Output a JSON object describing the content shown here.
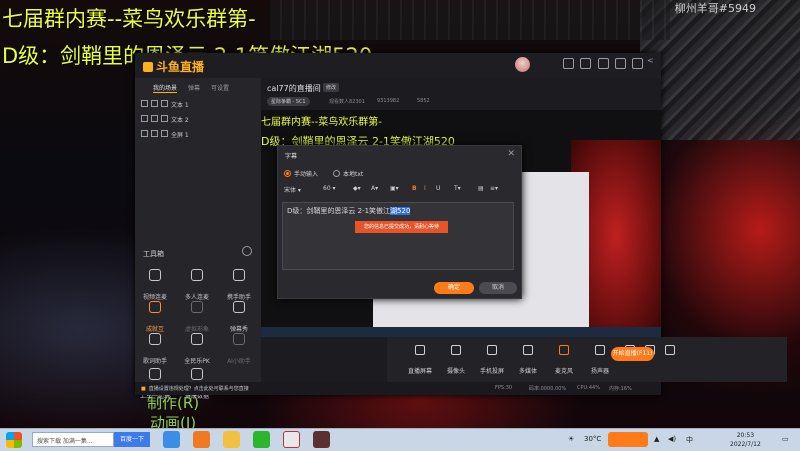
{
  "overlay": {
    "line1": "七届群内赛--菜鸟欢乐群第-",
    "line2": "D级：剑鞘里的恩泽云 2-1笑傲江湖520",
    "game_id": "柳州羊哥#5949",
    "zz1": "制作(R)",
    "zz2": "动画(I)"
  },
  "app": {
    "logo": "斗鱼直播",
    "sidebar_tabs": [
      "我的场景",
      "弹幕",
      "可设置"
    ],
    "layers": [
      "文本 1",
      "文本 2",
      "全屏 1"
    ],
    "tools_title": "工具箱",
    "tools": [
      {
        "label": "视频连麦",
        "state": "normal"
      },
      {
        "label": "多人连麦",
        "state": "normal"
      },
      {
        "label": "携手助手",
        "state": "normal"
      },
      {
        "label": "成就互",
        "state": "highlight"
      },
      {
        "label": "虚拟形象",
        "state": "dim"
      },
      {
        "label": "弹幕秀",
        "state": "normal"
      },
      {
        "label": "歌词助手",
        "state": "normal"
      },
      {
        "label": "全民乐PK",
        "state": "normal"
      },
      {
        "label": "AI小助手",
        "state": "dim"
      },
      {
        "label": "上车一起玩",
        "state": "normal"
      },
      {
        "label": "健康数据",
        "state": "normal"
      }
    ],
    "room_title": "cal77的直播间",
    "edit_label": "修改",
    "category": "星际争霸 · SC1",
    "viewer_meta": "观看数人82301",
    "fans_meta": "9313982",
    "likes_meta": "5852",
    "preview": {
      "line1": "七届群内赛--菜鸟欢乐群第-",
      "line2": "D级：剑鞘里的恩泽云 2-1笑傲江湖520",
      "zz1": "制作(R)",
      "zz2": "动画(I)"
    },
    "bottom_tools": [
      "直播屏幕",
      "摄像头",
      "手机投屏",
      "多媒体",
      "麦克风",
      "扬声器"
    ],
    "start_live": "开始直播(F11)",
    "notice": "直播设置违规处理？点击此处可联系与您直接",
    "stats": [
      "FPS:30",
      "码率:0000.00%",
      "CPU:44%",
      "内存:16%",
      "ID:??"
    ]
  },
  "dialog": {
    "title": "字幕",
    "radio_manual": "手动输入",
    "radio_file": "本地txt",
    "font_name": "宋体",
    "font_size": "60",
    "text_before": "D级：剑鞘里的恩泽云 2-1笑傲江",
    "text_selected": "湖520",
    "tip": "您的信息已提交成功，请耐心等待",
    "ok": "确定",
    "cancel": "取消"
  },
  "taskbar": {
    "search_text": "搜索下载 加满一集...",
    "search_button": "百度一下",
    "temperature": "30°C",
    "time": "20:53",
    "date": "2022/7/12"
  },
  "colors": {
    "accent": "#ff7a18",
    "overlay_text": "#eaff40",
    "overlay_green": "#8fd24a"
  }
}
